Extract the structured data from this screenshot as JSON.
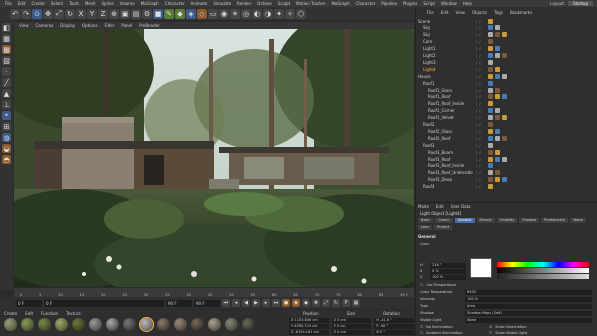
{
  "menubar": {
    "items": [
      "File",
      "Edit",
      "Create",
      "Select",
      "Tools",
      "Mesh",
      "Spline",
      "Volume",
      "MoGraph",
      "Character",
      "Animate",
      "Simulate",
      "Render",
      "Octane",
      "Sculpt",
      "Motion Tracker",
      "MoGraph",
      "Character",
      "Pipeline",
      "Plugins",
      "Script",
      "Window",
      "Help"
    ],
    "layout_label": "Layout:",
    "layout_value": "Startup"
  },
  "view_menu": [
    "View",
    "Cameras",
    "Display",
    "Options",
    "Filter",
    "Panel",
    "ProRender"
  ],
  "timeline": {
    "ticks": [
      "0",
      "5",
      "10",
      "15",
      "20",
      "25",
      "30",
      "35",
      "40",
      "45",
      "50",
      "55",
      "60",
      "65",
      "70",
      "75",
      "80",
      "85",
      "90 F"
    ]
  },
  "transport": {
    "start_frame": "0 F",
    "current_frame": "0 F",
    "end_frame": "90 F",
    "end_frame2": "90 F"
  },
  "material_menu": [
    "Create",
    "Edit",
    "Function",
    "Texture"
  ],
  "coordinates": {
    "headers": [
      "Position",
      "Size",
      "Rotation"
    ],
    "rows": [
      {
        "a": "X  1153.806 cm",
        "b": "X  0 cm",
        "c": "H  -41.6 °"
      },
      {
        "a": "Y  6390.724 cm",
        "b": "Y  0 cm",
        "c": "P  -90 °"
      },
      {
        "a": "Z  -6154.161 cm",
        "b": "Z  0 cm",
        "c": "B  0 °"
      }
    ]
  },
  "object_menu": [
    "File",
    "Edit",
    "View",
    "Objects",
    "Tags",
    "Bookmarks"
  ],
  "objects": [
    {
      "name": "Scene",
      "sel": false
    },
    {
      "name": "Sky",
      "sel": false
    },
    {
      "name": "Sky",
      "sel": false
    },
    {
      "name": "Cam",
      "sel": false
    },
    {
      "name": "Light1",
      "sel": false
    },
    {
      "name": "Light2",
      "sel": false
    },
    {
      "name": "Light3",
      "sel": false
    },
    {
      "name": "Light4",
      "sel": true
    },
    {
      "name": "House",
      "sel": false
    },
    {
      "name": "Roof1",
      "sel": false
    },
    {
      "name": "Roof1_Glass",
      "sel": false
    },
    {
      "name": "Roof1_Roof",
      "sel": false
    },
    {
      "name": "Roof1_Roof_Inside",
      "sel": false
    },
    {
      "name": "Roof1_Corner",
      "sel": false
    },
    {
      "name": "Roof1_Velvet",
      "sel": false
    },
    {
      "name": "Roof2",
      "sel": false
    },
    {
      "name": "Roof2_Glass",
      "sel": false
    },
    {
      "name": "Roof2_Roof",
      "sel": false
    },
    {
      "name": "Roof3",
      "sel": false
    },
    {
      "name": "Roof3_Beam",
      "sel": false
    },
    {
      "name": "Roof3_Roof",
      "sel": false
    },
    {
      "name": "Roof3_Roof_Inside",
      "sel": false
    },
    {
      "name": "Roof3_Roof_Underside",
      "sel": false
    },
    {
      "name": "Roof3_Deep",
      "sel": false
    },
    {
      "name": "Roof4",
      "sel": false
    }
  ],
  "attributes": {
    "menu": [
      "Mode",
      "Edit",
      "User Data"
    ],
    "title": "Light Object [Light4]",
    "tabs": [
      "Basic",
      "Coord.",
      "General",
      "Details",
      "Visibility",
      "Shadow",
      "Photometric",
      "Noise",
      "Lens",
      "Project"
    ],
    "active_tab": "General",
    "section": "General",
    "color_label": "Color",
    "h_label": "H",
    "h_value": "216 °",
    "s_label": "S",
    "s_value": "0 %",
    "v_label": "V",
    "v_value": "100 %",
    "use_temp_label": "Use Temperature",
    "temp_label": "Color Temperature",
    "temp_value": "6500",
    "intensity_label": "Intensity",
    "intensity_value": "100 %",
    "type_label": "Type",
    "type_value": "Area",
    "shadow_label": "Shadow",
    "shadow_value": "Shadow Maps (Soft)",
    "visible_light_label": "Visible Light",
    "visible_light_value": "None",
    "no_illum_label": "No Illumination",
    "show_illum_label": "Show Illumination",
    "ambient_label": "Ambient Illumination",
    "show_visible_label": "Show Visible Light"
  }
}
